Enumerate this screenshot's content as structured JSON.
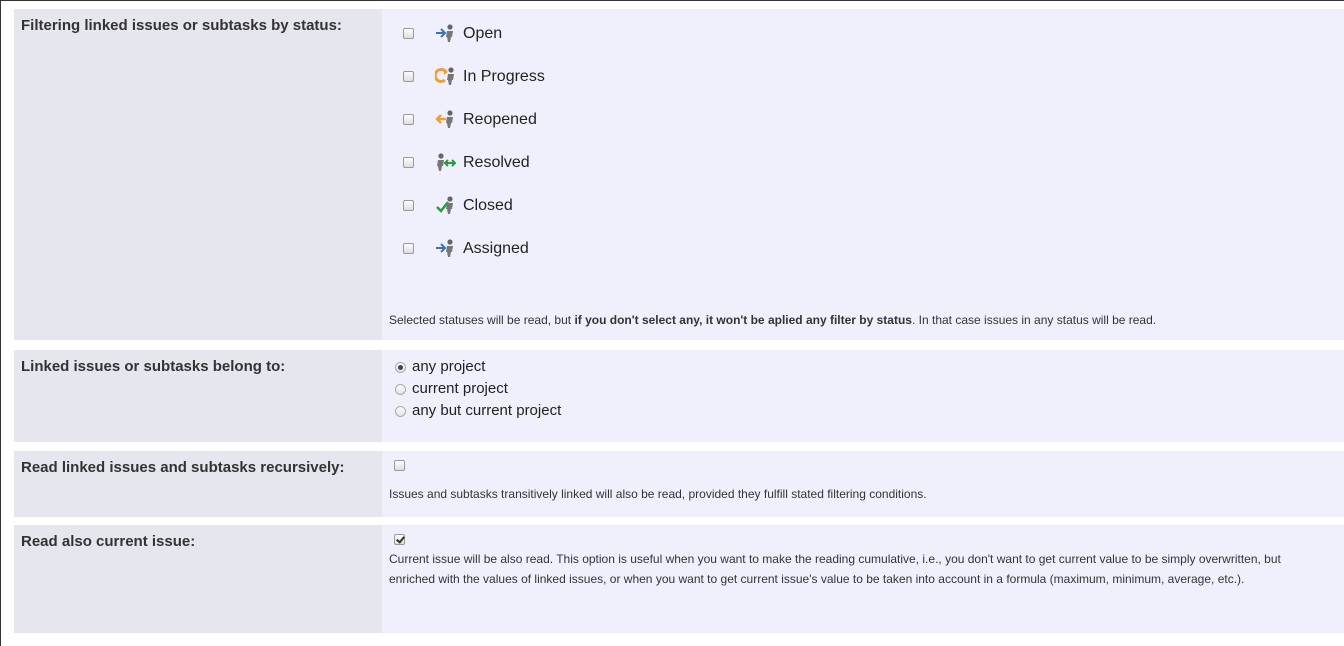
{
  "status_filter": {
    "label": "Filtering linked issues or subtasks by status:",
    "items": [
      {
        "label": "Open",
        "checked": false,
        "icon": "open-status-icon"
      },
      {
        "label": "In Progress",
        "checked": false,
        "icon": "in-progress-status-icon"
      },
      {
        "label": "Reopened",
        "checked": false,
        "icon": "reopened-status-icon"
      },
      {
        "label": "Resolved",
        "checked": false,
        "icon": "resolved-status-icon"
      },
      {
        "label": "Closed",
        "checked": false,
        "icon": "closed-status-icon"
      },
      {
        "label": "Assigned",
        "checked": false,
        "icon": "assigned-status-icon"
      }
    ],
    "note_prefix": "Selected statuses will be read, but ",
    "note_bold": "if you don't select any, it won't be aplied any filter by status",
    "note_suffix": ". In that case issues in any status will be read."
  },
  "project_scope": {
    "label": "Linked issues or subtasks belong to:",
    "options": [
      {
        "label": "any project",
        "selected": true
      },
      {
        "label": "current project",
        "selected": false
      },
      {
        "label": "any but current project",
        "selected": false
      }
    ]
  },
  "recursive": {
    "label": "Read linked issues and subtasks recursively:",
    "checked": false,
    "note": "Issues and subtasks transitively linked will also be read, provided they fulfill stated filtering conditions."
  },
  "current_issue": {
    "label": "Read also current issue:",
    "checked": true,
    "note": "Current issue will be also read. This option is useful when you want to make the reading cumulative, i.e., you don't want to get current value to be simply overwritten, but enriched with the values of linked issues, or when you want to get current issue's value to be taken into account in a formula (maximum, minimum, average, etc.)."
  },
  "colors": {
    "label_bg": "#e6e6ef",
    "content_bg": "#f0f0fc",
    "status_orange": "#f0a030",
    "status_blue": "#3b73b9",
    "status_green": "#2a9a3a"
  }
}
